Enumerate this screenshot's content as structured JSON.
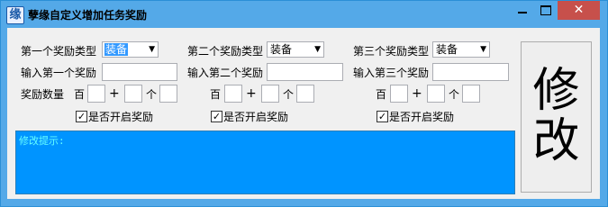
{
  "window": {
    "title": "孽缘自定义增加任务奖励",
    "icon_char": "缘",
    "close_glyph": "✕"
  },
  "rewards": [
    {
      "type_label": "第一个奖励类型",
      "type_value": "装备",
      "input_label": "输入第一个奖励",
      "input_value": "",
      "count_label": "奖励数量",
      "hundred": "百",
      "plus": "+",
      "unit": "个",
      "checkbox_label": "是否开启奖励",
      "checked": true
    },
    {
      "type_label": "第二个奖励类型",
      "type_value": "装备",
      "input_label": "输入第二个奖励",
      "input_value": "",
      "count_label": "",
      "hundred": "百",
      "plus": "+",
      "unit": "个",
      "checkbox_label": "是否开启奖励",
      "checked": true
    },
    {
      "type_label": "第三个奖励类型",
      "type_value": "装备",
      "input_label": "输入第三个奖励",
      "input_value": "",
      "count_label": "",
      "hundred": "百",
      "plus": "+",
      "unit": "个",
      "checkbox_label": "是否开启奖励",
      "checked": true
    }
  ],
  "message": {
    "text": "修改提示:"
  },
  "modify_button": {
    "line1": "修",
    "line2": "改"
  },
  "colors": {
    "titlebar": "#54a9e8",
    "close": "#c7504b",
    "message_bg": "#0094ff",
    "message_text": "#66ffff",
    "selected": "#3399ff"
  },
  "checkbox_mark": "✓",
  "dropdown_arrow": "▼"
}
